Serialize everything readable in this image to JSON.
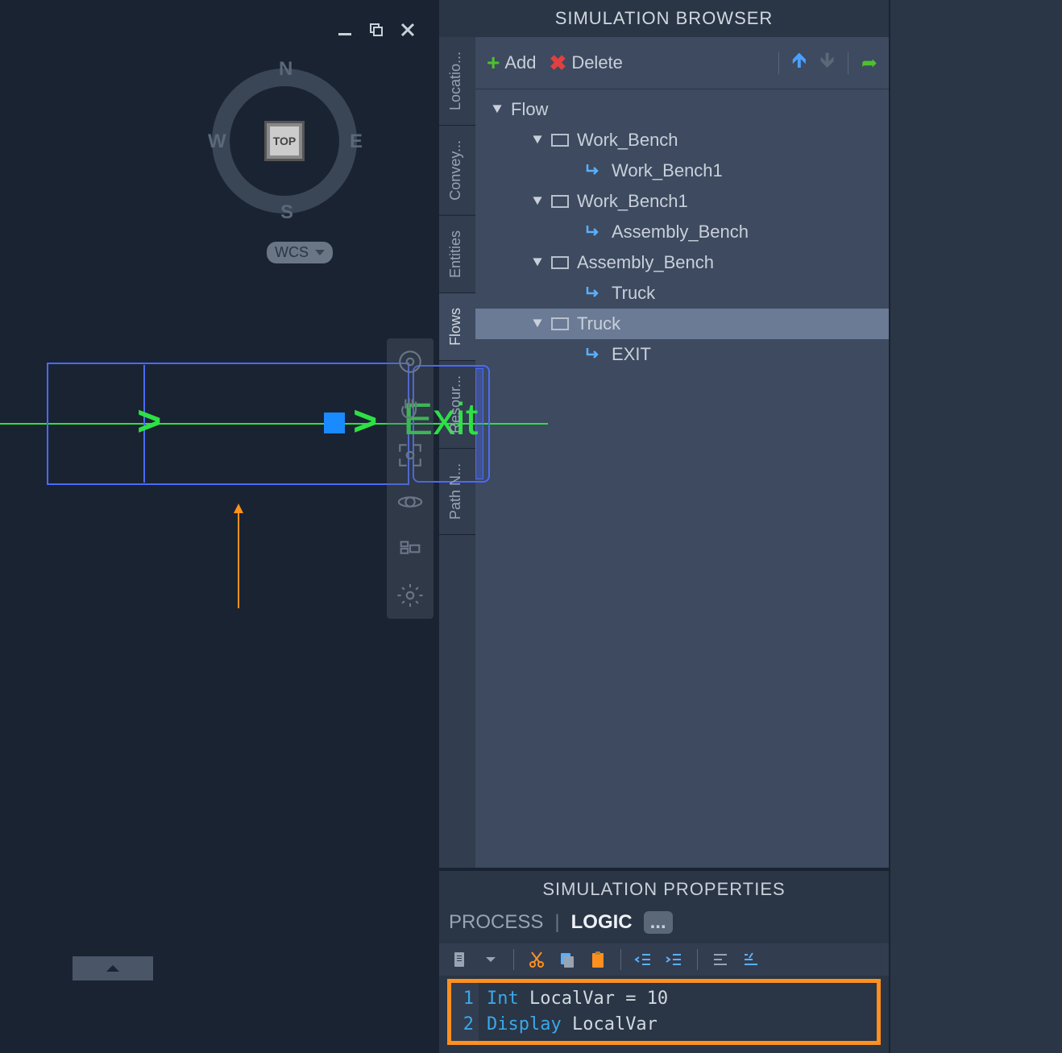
{
  "compass": {
    "top": "TOP",
    "n": "N",
    "s": "S",
    "e": "E",
    "w": "W"
  },
  "wcs_label": "WCS",
  "viewport": {
    "exit_label": "Exit"
  },
  "browser": {
    "title": "SIMULATION BROWSER",
    "toolbar": {
      "add": "Add",
      "delete": "Delete"
    },
    "vtabs": {
      "locations": "Locatio...",
      "conveyors": "Convey...",
      "entities": "Entities",
      "flows": "Flows",
      "resources": "Resour...",
      "pathnet": "Path N..."
    },
    "tree": {
      "root": "Flow",
      "wb": "Work_Bench",
      "wb1_child": "Work_Bench1",
      "wb1": "Work_Bench1",
      "ab_child": "Assembly_Bench",
      "ab": "Assembly_Bench",
      "truck_child": "Truck",
      "truck": "Truck",
      "exit": "EXIT"
    }
  },
  "props": {
    "title": "SIMULATION PROPERTIES",
    "tabs": {
      "process": "PROCESS",
      "logic": "LOGIC",
      "more": "..."
    },
    "code": {
      "line1_kw": "Int",
      "line1_rest": " LocalVar = 10",
      "line2_kw": "Display",
      "line2_rest": " LocalVar",
      "ln1": "1",
      "ln2": "2"
    }
  }
}
